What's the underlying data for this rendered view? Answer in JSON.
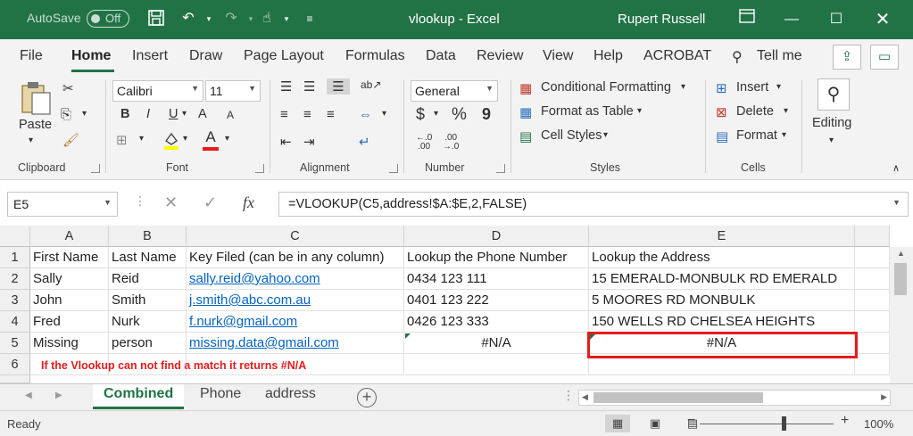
{
  "titlebar": {
    "autosave_label": "AutoSave",
    "autosave_state": "Off",
    "title": "vlookup  -  Excel",
    "user": "Rupert Russell",
    "accent": "#217346"
  },
  "tabs": [
    "File",
    "Home",
    "Insert",
    "Draw",
    "Page Layout",
    "Formulas",
    "Data",
    "Review",
    "View",
    "Help",
    "ACROBAT"
  ],
  "active_tab": "Home",
  "tell_me": "Tell me",
  "ribbon": {
    "clipboard": {
      "paste": "Paste",
      "label": "Clipboard"
    },
    "font": {
      "name": "Calibri",
      "size": "11",
      "label": "Font",
      "bold": "B",
      "italic": "I",
      "underline": "U",
      "grow": "A",
      "shrink": "A",
      "color_letter": "A"
    },
    "alignment": {
      "label": "Alignment"
    },
    "number": {
      "format": "General",
      "currency": "$",
      "percent": "%",
      "comma": "9",
      "label": "Number"
    },
    "styles": {
      "conditional": "Conditional Formatting",
      "table": "Format as Table",
      "cell": "Cell Styles",
      "label": "Styles"
    },
    "cells": {
      "insert": "Insert",
      "delete": "Delete",
      "format": "Format",
      "label": "Cells"
    },
    "editing": {
      "label": "Editing"
    }
  },
  "formula_bar": {
    "name_box": "E5",
    "fx": "fx",
    "formula": "=VLOOKUP(C5,address!$A:$E,2,FALSE)"
  },
  "grid": {
    "columns": [
      "A",
      "B",
      "C",
      "D",
      "E"
    ],
    "rows": [
      "1",
      "2",
      "3",
      "4",
      "5",
      "6"
    ],
    "cells": [
      [
        "First Name",
        "Last Name",
        "Key Filed (can be in any column)",
        "Lookup the Phone Number",
        "Lookup the Address"
      ],
      [
        "Sally",
        "Reid",
        "sally.reid@yahoo.com",
        "0434 123 111",
        "15 EMERALD-MONBULK RD EMERALD"
      ],
      [
        "John",
        "Smith",
        "j.smith@abc.com.au",
        "0401 123 222",
        "5 MOORES RD MONBULK"
      ],
      [
        "Fred",
        "Nurk",
        "f.nurk@gmail.com",
        "0426 123 333",
        "150 WELLS RD CHELSEA HEIGHTS"
      ],
      [
        "Missing",
        "person",
        "missing.data@gmail.com",
        "#N/A",
        "#N/A"
      ]
    ],
    "note": "If the Vlookup can not find a match it returns #N/A",
    "highlight_color": "#e51c1c",
    "link_color": "#0563c1"
  },
  "sheets": [
    "Combined",
    "Phone",
    "address"
  ],
  "active_sheet": "Combined",
  "status": {
    "ready": "Ready",
    "zoom": "100%"
  }
}
